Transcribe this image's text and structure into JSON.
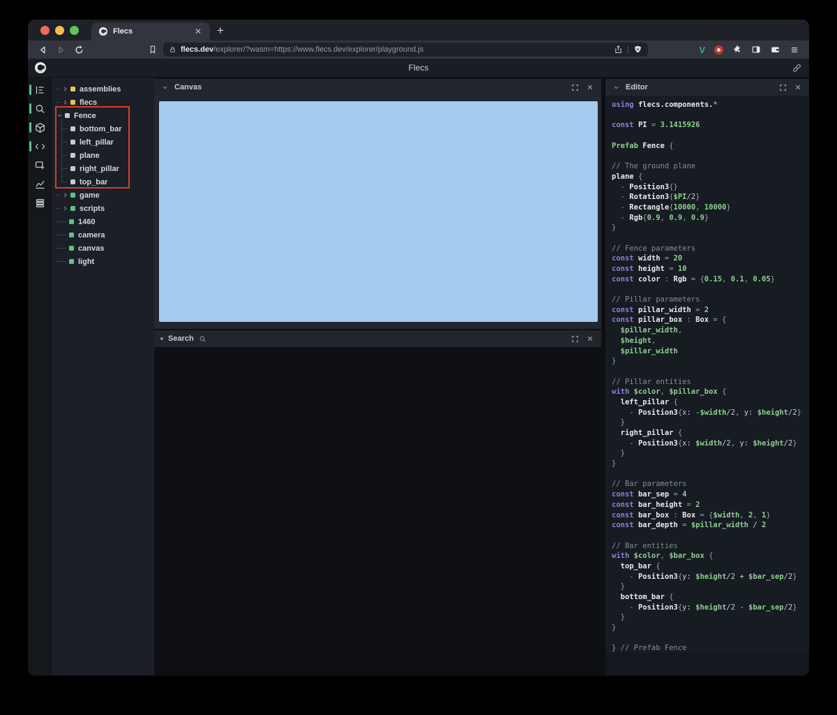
{
  "browser": {
    "tab": {
      "title": "Flecs"
    },
    "new_tab_label": "+",
    "url": {
      "domain": "flecs.dev",
      "path": "/explorer/?wasm=https://www.flecs.dev/explorer/playground.js"
    },
    "extensions": {
      "v_label": "V"
    }
  },
  "header": {
    "title": "Flecs"
  },
  "colors": {
    "canvas_blue": "#a5cbee",
    "highlight_red": "#d5402a",
    "indicator_green": "#5fc183",
    "traffic": [
      "#ee6a5f",
      "#f5bd4f",
      "#61c455"
    ]
  },
  "iconbar": {
    "items": [
      {
        "name": "hierarchy-icon",
        "active": true
      },
      {
        "name": "search-icon",
        "active": true
      },
      {
        "name": "cube-icon",
        "active": true
      },
      {
        "name": "code-icon",
        "active": true
      },
      {
        "name": "inspect-icon",
        "active": false
      },
      {
        "name": "stats-icon",
        "active": false
      },
      {
        "name": "stack-icon",
        "active": false
      }
    ]
  },
  "tree": {
    "items": [
      {
        "label": "assemblies",
        "dot": "#e5c558",
        "state": "collapsed"
      },
      {
        "label": "flecs",
        "dot": "#e5c558",
        "state": "collapsed"
      },
      {
        "label": "Fence",
        "dot": "#c6cad2",
        "state": "expanded",
        "children": [
          {
            "label": "bottom_bar",
            "dot": "#c6cad2"
          },
          {
            "label": "left_pillar",
            "dot": "#c6cad2"
          },
          {
            "label": "plane",
            "dot": "#c6cad2"
          },
          {
            "label": "right_pillar",
            "dot": "#c6cad2"
          },
          {
            "label": "top_bar",
            "dot": "#c6cad2"
          }
        ]
      },
      {
        "label": "game",
        "dot": "#64bf84",
        "state": "collapsed"
      },
      {
        "label": "scripts",
        "dot": "#64bf84",
        "state": "collapsed"
      },
      {
        "label": "1460",
        "dot": "#64bf84",
        "state": "leaf"
      },
      {
        "label": "camera",
        "dot": "#64bf84",
        "state": "leaf"
      },
      {
        "label": "canvas",
        "dot": "#64bf84",
        "state": "leaf"
      },
      {
        "label": "light",
        "dot": "#64bf84",
        "state": "leaf"
      }
    ]
  },
  "panels": {
    "canvas": {
      "title": "Canvas"
    },
    "search": {
      "title": "Search"
    },
    "editor": {
      "title": "Editor"
    }
  },
  "editor_code": {
    "lines": [
      [
        [
          "k",
          "using "
        ],
        [
          "i",
          "flecs.components."
        ],
        [
          "t",
          "*"
        ]
      ],
      [],
      [
        [
          "k",
          "const "
        ],
        [
          "i",
          "PI"
        ],
        [
          "p",
          " = "
        ],
        [
          "n",
          "3.1415926"
        ]
      ],
      [],
      [
        [
          "n",
          "Prefab "
        ],
        [
          "i",
          "Fence "
        ],
        [
          "p",
          "{"
        ]
      ],
      [],
      [
        [
          "c",
          "// The ground plane"
        ]
      ],
      [
        [
          "i",
          "plane "
        ],
        [
          "p",
          "{"
        ]
      ],
      [
        [
          "p",
          "  - "
        ],
        [
          "i",
          "Position3"
        ],
        [
          "p",
          "{}"
        ]
      ],
      [
        [
          "p",
          "  - "
        ],
        [
          "i",
          "Rotation3"
        ],
        [
          "p",
          "{"
        ],
        [
          "n",
          "$PI"
        ],
        [
          "t",
          "/2"
        ],
        [
          "p",
          "}"
        ]
      ],
      [
        [
          "p",
          "  - "
        ],
        [
          "i",
          "Rectangle"
        ],
        [
          "p",
          "{"
        ],
        [
          "n",
          "10000"
        ],
        [
          "p",
          ", "
        ],
        [
          "n",
          "10000"
        ],
        [
          "p",
          "}"
        ]
      ],
      [
        [
          "p",
          "  - "
        ],
        [
          "i",
          "Rgb"
        ],
        [
          "p",
          "{"
        ],
        [
          "n",
          "0.9"
        ],
        [
          "p",
          ", "
        ],
        [
          "n",
          "0.9"
        ],
        [
          "p",
          ", "
        ],
        [
          "n",
          "0.9"
        ],
        [
          "p",
          "}"
        ]
      ],
      [
        [
          "p",
          "}"
        ]
      ],
      [],
      [
        [
          "c",
          "// Fence parameters"
        ]
      ],
      [
        [
          "k",
          "const "
        ],
        [
          "i",
          "width"
        ],
        [
          "p",
          " = "
        ],
        [
          "n",
          "20"
        ]
      ],
      [
        [
          "k",
          "const "
        ],
        [
          "i",
          "height"
        ],
        [
          "p",
          " = "
        ],
        [
          "n",
          "10"
        ]
      ],
      [
        [
          "k",
          "const "
        ],
        [
          "i",
          "color"
        ],
        [
          "p",
          " : "
        ],
        [
          "i",
          "Rgb"
        ],
        [
          "p",
          " = {"
        ],
        [
          "n",
          "0.15"
        ],
        [
          "p",
          ", "
        ],
        [
          "n",
          "0.1"
        ],
        [
          "p",
          ", "
        ],
        [
          "n",
          "0.05"
        ],
        [
          "p",
          "}"
        ]
      ],
      [],
      [
        [
          "c",
          "// Pillar parameters"
        ]
      ],
      [
        [
          "k",
          "const "
        ],
        [
          "i",
          "pillar_width"
        ],
        [
          "p",
          " = "
        ],
        [
          "n",
          "2"
        ]
      ],
      [
        [
          "k",
          "const "
        ],
        [
          "i",
          "pillar_box"
        ],
        [
          "p",
          " : "
        ],
        [
          "i",
          "Box"
        ],
        [
          "p",
          " = {"
        ]
      ],
      [
        [
          "n",
          "  $pillar_width"
        ],
        [
          "p",
          ","
        ]
      ],
      [
        [
          "n",
          "  $height"
        ],
        [
          "p",
          ","
        ]
      ],
      [
        [
          "n",
          "  $pillar_width"
        ]
      ],
      [
        [
          "p",
          "}"
        ]
      ],
      [],
      [
        [
          "c",
          "// Pillar entities"
        ]
      ],
      [
        [
          "k",
          "with "
        ],
        [
          "n",
          "$color"
        ],
        [
          "p",
          ", "
        ],
        [
          "n",
          "$pillar_box"
        ],
        [
          "p",
          " {"
        ]
      ],
      [
        [
          "i",
          "  left_pillar "
        ],
        [
          "p",
          "{"
        ]
      ],
      [
        [
          "p",
          "    - "
        ],
        [
          "i",
          "Position3"
        ],
        [
          "p",
          "{"
        ],
        [
          "t",
          "x: -"
        ],
        [
          "n",
          "$width"
        ],
        [
          "t",
          "/2"
        ],
        [
          "p",
          ", "
        ],
        [
          "t",
          "y: "
        ],
        [
          "n",
          "$height"
        ],
        [
          "t",
          "/2"
        ],
        [
          "p",
          "}"
        ]
      ],
      [
        [
          "p",
          "  }"
        ]
      ],
      [
        [
          "i",
          "  right_pillar "
        ],
        [
          "p",
          "{"
        ]
      ],
      [
        [
          "p",
          "    - "
        ],
        [
          "i",
          "Position3"
        ],
        [
          "p",
          "{"
        ],
        [
          "t",
          "x: "
        ],
        [
          "n",
          "$width"
        ],
        [
          "t",
          "/2"
        ],
        [
          "p",
          ", "
        ],
        [
          "t",
          "y: "
        ],
        [
          "n",
          "$height"
        ],
        [
          "t",
          "/2"
        ],
        [
          "p",
          "}"
        ]
      ],
      [
        [
          "p",
          "  }"
        ]
      ],
      [
        [
          "p",
          "}"
        ]
      ],
      [],
      [
        [
          "c",
          "// Bar parameters"
        ]
      ],
      [
        [
          "k",
          "const "
        ],
        [
          "i",
          "bar_sep"
        ],
        [
          "p",
          " = "
        ],
        [
          "n",
          "4"
        ]
      ],
      [
        [
          "k",
          "const "
        ],
        [
          "i",
          "bar_height"
        ],
        [
          "p",
          " = "
        ],
        [
          "n",
          "2"
        ]
      ],
      [
        [
          "k",
          "const "
        ],
        [
          "i",
          "bar_box"
        ],
        [
          "p",
          " : "
        ],
        [
          "i",
          "Box"
        ],
        [
          "p",
          " = {"
        ],
        [
          "n",
          "$width"
        ],
        [
          "p",
          ", "
        ],
        [
          "n",
          "2"
        ],
        [
          "p",
          ", "
        ],
        [
          "n",
          "1"
        ],
        [
          "p",
          "}"
        ]
      ],
      [
        [
          "k",
          "const "
        ],
        [
          "i",
          "bar_depth"
        ],
        [
          "p",
          " = "
        ],
        [
          "n",
          "$pillar_width"
        ],
        [
          "t",
          " / "
        ],
        [
          "n",
          "2"
        ]
      ],
      [],
      [
        [
          "c",
          "// Bar entities"
        ]
      ],
      [
        [
          "k",
          "with "
        ],
        [
          "n",
          "$color"
        ],
        [
          "p",
          ", "
        ],
        [
          "n",
          "$bar_box"
        ],
        [
          "p",
          " {"
        ]
      ],
      [
        [
          "i",
          "  top_bar "
        ],
        [
          "p",
          "{"
        ]
      ],
      [
        [
          "p",
          "    - "
        ],
        [
          "i",
          "Position3"
        ],
        [
          "p",
          "{"
        ],
        [
          "t",
          "y: "
        ],
        [
          "n",
          "$height"
        ],
        [
          "t",
          "/2 + "
        ],
        [
          "n",
          "$bar_sep"
        ],
        [
          "t",
          "/2"
        ],
        [
          "p",
          "}"
        ]
      ],
      [
        [
          "p",
          "  }"
        ]
      ],
      [
        [
          "i",
          "  bottom_bar "
        ],
        [
          "p",
          "{"
        ]
      ],
      [
        [
          "p",
          "    - "
        ],
        [
          "i",
          "Position3"
        ],
        [
          "p",
          "{"
        ],
        [
          "t",
          "y: "
        ],
        [
          "n",
          "$height"
        ],
        [
          "t",
          "/2 - "
        ],
        [
          "n",
          "$bar_sep"
        ],
        [
          "t",
          "/2"
        ],
        [
          "p",
          "}"
        ]
      ],
      [
        [
          "p",
          "  }"
        ]
      ],
      [
        [
          "p",
          "}"
        ]
      ],
      [],
      [
        [
          "p",
          "} "
        ],
        [
          "c",
          "// Prefab Fence"
        ]
      ]
    ]
  }
}
